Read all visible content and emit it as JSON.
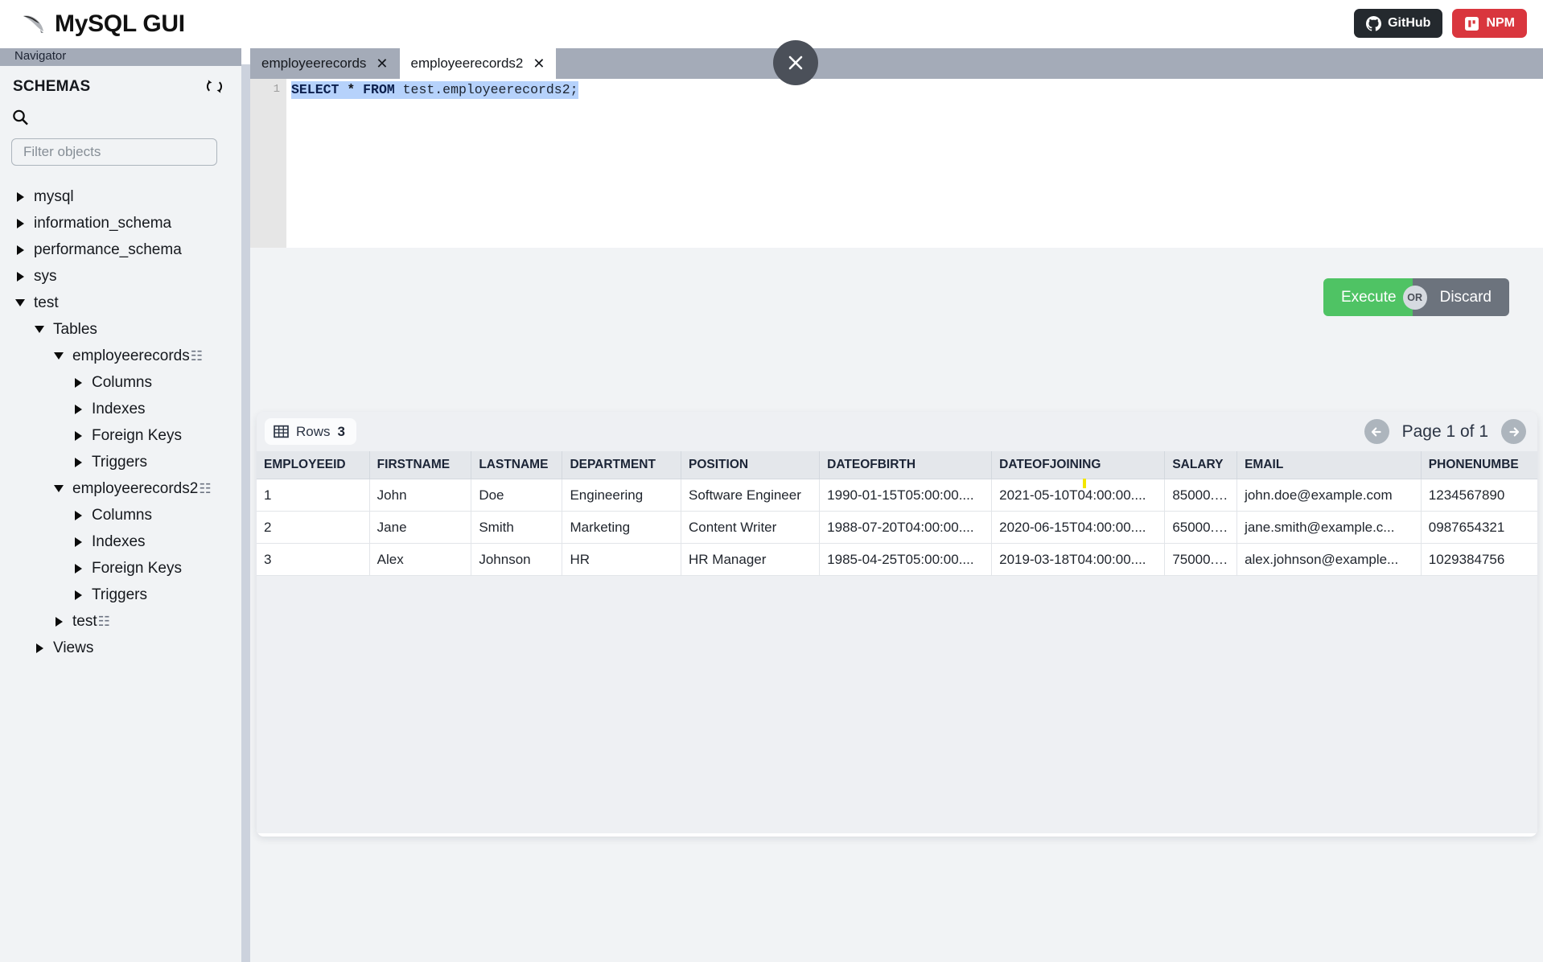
{
  "app": {
    "title": "MySQL GUI",
    "logo_icon": "mysql-dolphin-icon"
  },
  "topbar": {
    "buttons": [
      {
        "label": "GitHub",
        "icon": "github-icon",
        "color": "#24292e"
      },
      {
        "label": "NPM",
        "icon": "npm-icon",
        "color": "#d9363e"
      }
    ]
  },
  "sidebar": {
    "navigator_label": "Navigator",
    "schemas_label": "SCHEMAS",
    "refresh_icon": "refresh-icon",
    "search_icon": "search-icon",
    "filter_placeholder": "Filter objects",
    "filter_value": "",
    "tree": [
      {
        "label": "mysql",
        "depth": 0,
        "state": "closed",
        "table_glyph": false
      },
      {
        "label": "information_schema",
        "depth": 0,
        "state": "closed",
        "table_glyph": false
      },
      {
        "label": "performance_schema",
        "depth": 0,
        "state": "closed",
        "table_glyph": false
      },
      {
        "label": "sys",
        "depth": 0,
        "state": "closed",
        "table_glyph": false
      },
      {
        "label": "test",
        "depth": 0,
        "state": "open",
        "table_glyph": false
      },
      {
        "label": "Tables",
        "depth": 1,
        "state": "open",
        "table_glyph": false
      },
      {
        "label": "employeerecords",
        "depth": 2,
        "state": "open",
        "table_glyph": true
      },
      {
        "label": "Columns",
        "depth": 3,
        "state": "closed",
        "table_glyph": false
      },
      {
        "label": "Indexes",
        "depth": 3,
        "state": "closed",
        "table_glyph": false
      },
      {
        "label": "Foreign Keys",
        "depth": 3,
        "state": "closed",
        "table_glyph": false
      },
      {
        "label": "Triggers",
        "depth": 3,
        "state": "closed",
        "table_glyph": false
      },
      {
        "label": "employeerecords2",
        "depth": 2,
        "state": "open",
        "table_glyph": true
      },
      {
        "label": "Columns",
        "depth": 3,
        "state": "closed",
        "table_glyph": false
      },
      {
        "label": "Indexes",
        "depth": 3,
        "state": "closed",
        "table_glyph": false
      },
      {
        "label": "Foreign Keys",
        "depth": 3,
        "state": "closed",
        "table_glyph": false
      },
      {
        "label": "Triggers",
        "depth": 3,
        "state": "closed",
        "table_glyph": false
      },
      {
        "label": "test",
        "depth": 2,
        "state": "closed",
        "table_glyph": true
      },
      {
        "label": "Views",
        "depth": 1,
        "state": "closed",
        "table_glyph": false
      }
    ]
  },
  "editor": {
    "tabs": [
      {
        "label": "employeerecords",
        "active": false,
        "close_icon": "close-icon"
      },
      {
        "label": "employeerecords2",
        "active": true,
        "close_icon": "close-icon"
      }
    ],
    "close_overlay_icon": "close-circle-icon",
    "line_number": "1",
    "sql": {
      "full": "SELECT * FROM test.employeerecords2;",
      "tokens": [
        {
          "text": "SELECT",
          "type": "keyword"
        },
        {
          "text": " ",
          "type": "plain"
        },
        {
          "text": "*",
          "type": "operator"
        },
        {
          "text": " ",
          "type": "plain"
        },
        {
          "text": "FROM",
          "type": "keyword"
        },
        {
          "text": " ",
          "type": "plain"
        },
        {
          "text": "test.employeerecords2;",
          "type": "identifier"
        }
      ]
    },
    "execute_label": "Execute",
    "or_label": "OR",
    "discard_label": "Discard",
    "colors": {
      "execute": "#4fc364",
      "discard": "#6c737d"
    }
  },
  "results": {
    "rows_label": "Rows",
    "rows_count": "3",
    "rows_icon": "table-grid-icon",
    "page_label": "Page 1 of 1",
    "prev_icon": "arrow-left-icon",
    "next_icon": "arrow-right-icon",
    "columns": [
      "EMPLOYEEID",
      "FIRSTNAME",
      "LASTNAME",
      "DEPARTMENT",
      "POSITION",
      "DATEOFBIRTH",
      "DATEOFJOINING",
      "SALARY",
      "EMAIL",
      "PHONENUMBE"
    ],
    "rows": [
      [
        "1",
        "John",
        "Doe",
        "Engineering",
        "Software Engineer",
        "1990-01-15T05:00:00....",
        "2021-05-10T04:00:00....",
        "85000.00",
        "john.doe@example.com",
        "1234567890"
      ],
      [
        "2",
        "Jane",
        "Smith",
        "Marketing",
        "Content Writer",
        "1988-07-20T04:00:00....",
        "2020-06-15T04:00:00....",
        "65000.00",
        "jane.smith@example.c...",
        "0987654321"
      ],
      [
        "3",
        "Alex",
        "Johnson",
        "HR",
        "HR Manager",
        "1985-04-25T05:00:00....",
        "2019-03-18T04:00:00....",
        "75000.00",
        "alex.johnson@example...",
        "1029384756"
      ]
    ]
  }
}
